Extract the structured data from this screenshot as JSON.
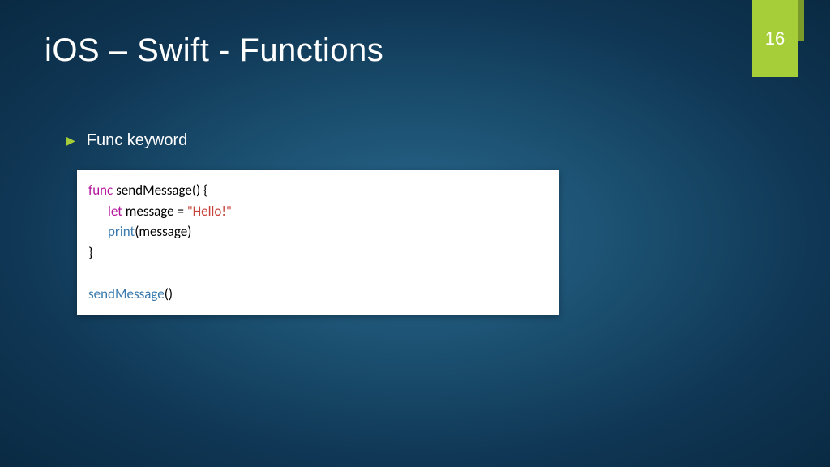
{
  "slide": {
    "title": "iOS – Swift - Functions",
    "pageNumber": "16",
    "bullet": "Func keyword",
    "code": {
      "line1_kw": "func",
      "line1_name": " sendMessage",
      "line1_rest": "() {",
      "line2_kw": "let",
      "line2_mid": " message = ",
      "line2_str": "\"Hello!\"",
      "line3_fn": "print",
      "line3_rest": "(message)",
      "line4": "}",
      "line6_fn": "sendMessage",
      "line6_rest": "()"
    }
  }
}
